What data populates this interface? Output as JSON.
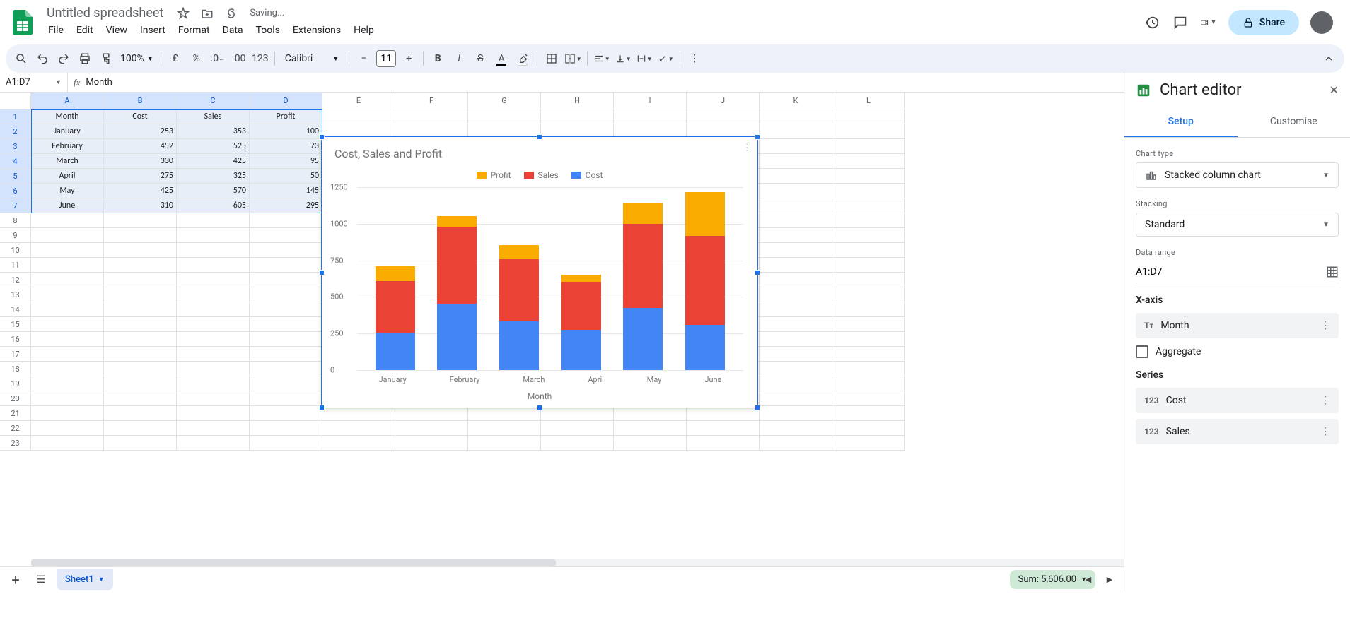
{
  "doc": {
    "title": "Untitled spreadsheet",
    "saving": "Saving..."
  },
  "menubar": [
    "File",
    "Edit",
    "View",
    "Insert",
    "Format",
    "Data",
    "Tools",
    "Extensions",
    "Help"
  ],
  "toolbar": {
    "zoom": "100%",
    "currency": "£",
    "percent": "%",
    "format_num": "123",
    "font": "Calibri",
    "font_size": "11"
  },
  "header_right": {
    "share": "Share"
  },
  "name_box": "A1:D7",
  "fx_value": "Month",
  "columns": [
    "A",
    "B",
    "C",
    "D",
    "E",
    "F",
    "G",
    "H",
    "I",
    "J",
    "K",
    "L"
  ],
  "col_sel_count": 4,
  "rows_count": 23,
  "row_sel_count": 7,
  "table": {
    "headers": [
      "Month",
      "Cost",
      "Sales",
      "Profit"
    ],
    "rows": [
      [
        "January",
        "253",
        "353",
        "100"
      ],
      [
        "February",
        "452",
        "525",
        "73"
      ],
      [
        "March",
        "330",
        "425",
        "95"
      ],
      [
        "April",
        "275",
        "325",
        "50"
      ],
      [
        "May",
        "425",
        "570",
        "145"
      ],
      [
        "June",
        "310",
        "605",
        "295"
      ]
    ]
  },
  "chart_data": {
    "type": "bar",
    "stacked": true,
    "title": "Cost, Sales and Profit",
    "xlabel": "Month",
    "ylabel": "",
    "ylim": [
      0,
      1250
    ],
    "y_ticks": [
      0,
      250,
      500,
      750,
      1000,
      1250
    ],
    "categories": [
      "January",
      "February",
      "March",
      "April",
      "May",
      "June"
    ],
    "series": [
      {
        "name": "Profit",
        "values": [
          100,
          73,
          95,
          50,
          145,
          295
        ],
        "color": "#f9ab00"
      },
      {
        "name": "Sales",
        "values": [
          353,
          525,
          425,
          325,
          570,
          605
        ],
        "color": "#ea4335"
      },
      {
        "name": "Cost",
        "values": [
          253,
          452,
          330,
          275,
          425,
          310
        ],
        "color": "#4285f4"
      }
    ]
  },
  "sheet_tabs": {
    "active": "Sheet1"
  },
  "sum_badge": "Sum: 5,606.00",
  "sidebar": {
    "title": "Chart editor",
    "tabs": {
      "setup": "Setup",
      "customise": "Customise"
    },
    "chart_type_label": "Chart type",
    "chart_type_value": "Stacked column chart",
    "stacking_label": "Stacking",
    "stacking_value": "Standard",
    "data_range_label": "Data range",
    "data_range_value": "A1:D7",
    "xaxis_label": "X-axis",
    "xaxis_value": "Month",
    "aggregate": "Aggregate",
    "series_label": "Series",
    "series_items": [
      "Cost",
      "Sales"
    ]
  }
}
